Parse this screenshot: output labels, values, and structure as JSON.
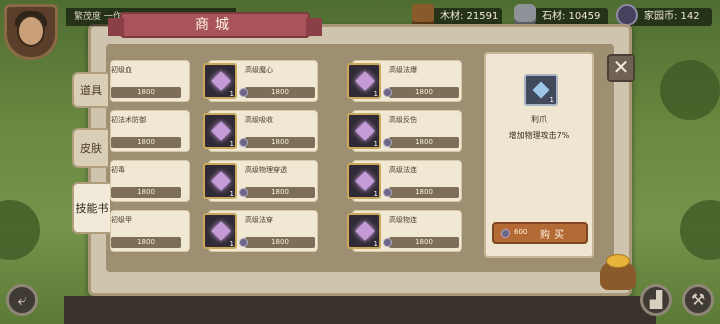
{
  "player": {
    "name": "繁茂度 一作..."
  },
  "resources": [
    {
      "icon": "wood-icon",
      "label": "木材: 21591"
    },
    {
      "icon": "stone-icon",
      "label": "石材: 10459"
    },
    {
      "icon": "home-coin-icon",
      "label": "家园币: 142"
    }
  ],
  "shop": {
    "title": "商城"
  },
  "tabs": [
    {
      "label": "道具"
    },
    {
      "label": "皮肤"
    },
    {
      "label": "技能书",
      "active": true
    }
  ],
  "items": [
    [
      {
        "name": "初级血",
        "price": "1800"
      },
      {
        "name": "高级魔心",
        "price": "1800"
      },
      {
        "name": "高级法爆",
        "price": "1800"
      }
    ],
    [
      {
        "name": "初法术防御",
        "price": "1800"
      },
      {
        "name": "高级吸收",
        "price": "1800"
      },
      {
        "name": "高级反伤",
        "price": "1800"
      }
    ],
    [
      {
        "name": "初毒",
        "price": "1800"
      },
      {
        "name": "高级物理穿透",
        "price": "1800"
      },
      {
        "name": "高级法连",
        "price": "1800"
      }
    ],
    [
      {
        "name": "初级甲",
        "price": "1800"
      },
      {
        "name": "高级法穿",
        "price": "1800"
      },
      {
        "name": "高级物连",
        "price": "1800"
      }
    ]
  ],
  "item_qty": "1",
  "detail": {
    "qty": "1",
    "name": "利爪",
    "description": "增加物理攻击7%",
    "price": "600",
    "buy_label": "购买"
  },
  "colors": {
    "accent_ribbon": "#a8545a",
    "buy_button": "#b46a34",
    "panel": "#cfc4ad"
  }
}
